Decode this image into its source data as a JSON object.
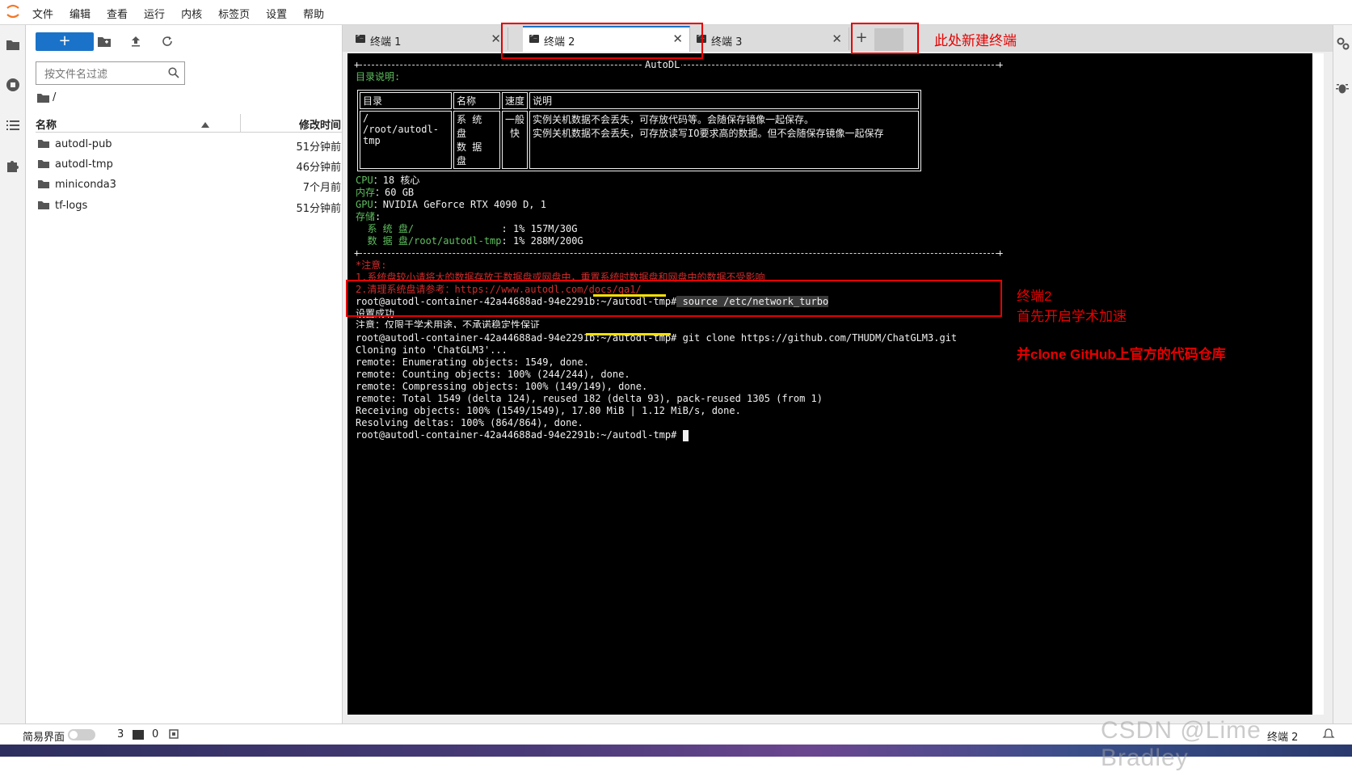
{
  "menubar": {
    "items": [
      "文件",
      "编辑",
      "查看",
      "运行",
      "内核",
      "标签页",
      "设置",
      "帮助"
    ]
  },
  "filebrowser": {
    "new_button_label": "+",
    "filter_placeholder": "按文件名过滤",
    "breadcrumb": "/",
    "column_name": "名称",
    "column_modified": "修改时间",
    "files": [
      {
        "name": "autodl-pub",
        "modified": "51分钟前"
      },
      {
        "name": "autodl-tmp",
        "modified": "46分钟前"
      },
      {
        "name": "miniconda3",
        "modified": "7个月前"
      },
      {
        "name": "tf-logs",
        "modified": "51分钟前"
      }
    ]
  },
  "tabs": [
    {
      "label": "终端 1",
      "active": false
    },
    {
      "label": "终端 2",
      "active": true
    },
    {
      "label": "终端 3",
      "active": false
    }
  ],
  "new_tab_label": "+",
  "terminal": {
    "rule_label": "AutoDL",
    "dir_heading": "目录说明:",
    "table": {
      "headers": [
        "目录",
        "名称",
        "速度",
        "说明"
      ],
      "col_dir": [
        "/",
        "/root/autodl-tmp"
      ],
      "col_name": [
        "系 统 盘",
        "数 据 盘"
      ],
      "col_speed": [
        "一般",
        "快"
      ],
      "col_desc": [
        "实例关机数据不会丢失，可存放代码等。会随保存镜像一起保存。",
        "实例关机数据不会丢失，可存放读写IO要求高的数据。但不会随保存镜像一起保存"
      ]
    },
    "specs": [
      {
        "label": "CPU",
        "value": "：18 核心"
      },
      {
        "label": "内存",
        "value": "：60 GB"
      },
      {
        "label": "GPU",
        "value": "：NVIDIA GeForce RTX 4090 D, 1"
      },
      {
        "label": "存储",
        "value": ":"
      }
    ],
    "storage": [
      {
        "label": "  系 统 盘/               ",
        "value": ": 1% 157M/30G"
      },
      {
        "label": "  数 据 盘/root/autodl-tmp",
        "value": ": 1% 288M/200G"
      }
    ],
    "notes": [
      "*注意:",
      "1.系统盘较小请将大的数据存放于数据盘或网盘中，重置系统时数据盘和网盘中的数据不受影响",
      "2.清理系统盘请参考：https://www.autodl.com/docs/qa1/"
    ],
    "prompt": "root@autodl-container-42a44688ad-94e2291b:~/autodl-tmp#",
    "cmd1": " source /etc/network_turbo",
    "out1": [
      "设置成功",
      "注意：仅限于学术用途，不承诺稳定性保证"
    ],
    "cmd2": " git clone https://github.com/THUDM/ChatGLM3.git",
    "out2": [
      "Cloning into 'ChatGLM3'...",
      "remote: Enumerating objects: 1549, done.",
      "remote: Counting objects: 100% (244/244), done.",
      "remote: Compressing objects: 100% (149/149), done.",
      "remote: Total 1549 (delta 124), reused 182 (delta 93), pack-reused 1305 (from 1)",
      "Receiving objects: 100% (1549/1549), 17.80 MiB | 1.12 MiB/s, done.",
      "Resolving deltas: 100% (864/864), done."
    ],
    "prompt_final": "root@autodl-container-42a44688ad-94e2291b:~/autodl-tmp#"
  },
  "annotations": {
    "new_terminal": "此处新建终端",
    "term2_title": "终端2",
    "term2_line1": "首先开启学术加速",
    "term2_line2": "并clone GitHub上官方的代码仓库"
  },
  "statusbar": {
    "simple_mode_label": "简易界面",
    "terminals_count": "3",
    "kernels_count": "0",
    "current_terminal": "终端 2"
  },
  "watermark": "CSDN @Lime Bradley",
  "colors": {
    "accent": "#1a73c8",
    "annotation_red": "#e60000",
    "highlight_yellow": "#f5e000",
    "terminal_green": "#5fc05f",
    "terminal_red": "#d22c2c"
  }
}
